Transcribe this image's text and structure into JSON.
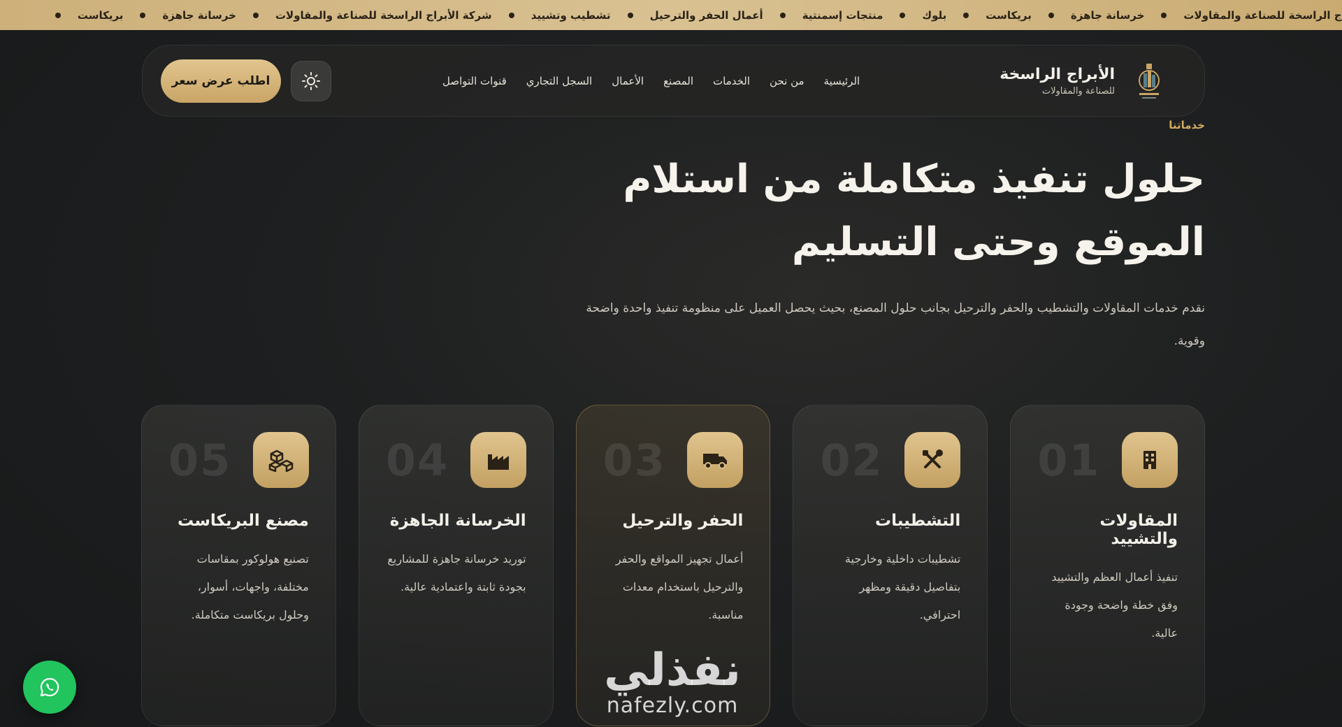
{
  "ticker": {
    "items": [
      "الأبراج الراسخة للصناعة والمقاولات",
      "خرسانة جاهزة",
      "بريكاست",
      "بلوك",
      "منتجات إسمنتية",
      "أعمال الحفر والترحيل",
      "تشطيب وتشييد",
      "شركة الأبراج الراسخة للصناعة والمقاولات",
      "خرسانة جاهزة",
      "بريكاست"
    ]
  },
  "brand": {
    "name": "الأبراج الراسخة",
    "subtitle": "للصناعة والمقاولات",
    "logo_icon": "tower-logo-icon"
  },
  "nav": {
    "links": [
      "الرئيسية",
      "من نحن",
      "الخدمات",
      "المصنع",
      "الأعمال",
      "السجل التجاري",
      "قنوات التواصل"
    ],
    "theme_icon": "sun-icon",
    "quote_label": "اطلب عرض سعر"
  },
  "hero": {
    "eyebrow": "خدماتنا",
    "title": "حلول تنفيذ متكاملة من استلام الموقع وحتى التسليم",
    "description": "نقدم خدمات المقاولات والتشطيب والحفر والترحيل بجانب حلول المصنع، بحيث يحصل العميل على منظومة تنفيذ واحدة واضحة وقوية."
  },
  "cards": [
    {
      "num": "01",
      "title": "المقاولات والتشييد",
      "text": "تنفيذ أعمال العظم والتشييد وفق خطة واضحة وجودة عالية.",
      "icon": "building-icon"
    },
    {
      "num": "02",
      "title": "التشطيبات",
      "text": "تشطيبات داخلية وخارجية بتفاصيل دقيقة ومظهر احترافي.",
      "icon": "tools-icon"
    },
    {
      "num": "03",
      "title": "الحفر والترحيل",
      "text": "أعمال تجهيز المواقع والحفر والترحيل باستخدام معدات مناسبة.",
      "icon": "truck-icon"
    },
    {
      "num": "04",
      "title": "الخرسانة الجاهزة",
      "text": "توريد خرسانة جاهزة للمشاريع بجودة ثابتة واعتمادية عالية.",
      "icon": "factory-icon"
    },
    {
      "num": "05",
      "title": "مصنع البريكاست",
      "text": "تصنيع هولوكور بمقاسات مختلفة، واجهات، أسوار، وحلول بريكاست متكاملة.",
      "icon": "cubes-icon"
    }
  ],
  "watermark": {
    "arabic": "نفذلي",
    "latin": "nafezly.com"
  },
  "whatsapp": {
    "icon": "whatsapp-icon"
  },
  "colors": {
    "accent": "#d2ad63",
    "ticker_bg": "#d3b885",
    "whatsapp": "#21c45d"
  }
}
